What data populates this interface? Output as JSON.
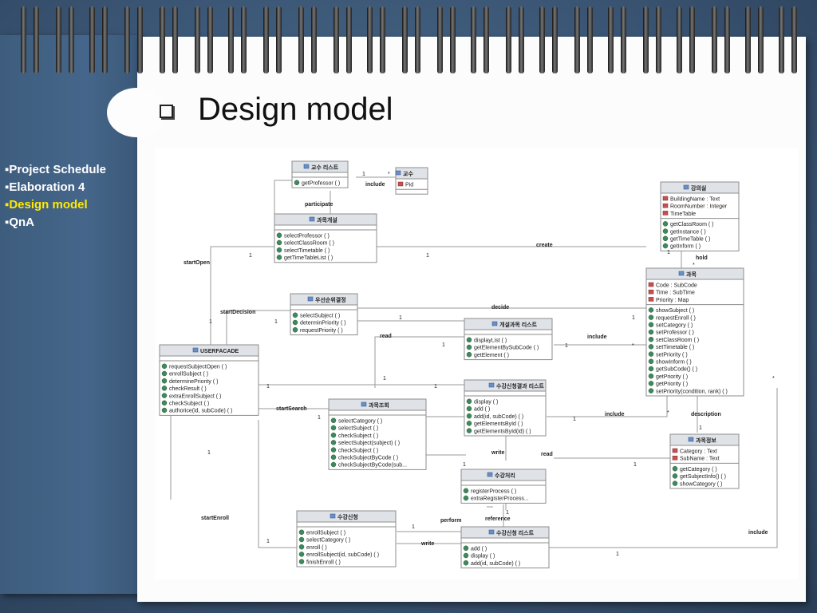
{
  "slide": {
    "title": "Design model"
  },
  "menu": [
    {
      "label": "▪Project Schedule",
      "active": false
    },
    {
      "label": "▪Elaboration 4",
      "active": false
    },
    {
      "label": "▪Design model",
      "active": true
    },
    {
      "label": "▪QnA",
      "active": false
    }
  ],
  "classes": {
    "prof_list": {
      "name": "교수 리스트",
      "attrs": [],
      "ops": [
        "getProfessor ( )"
      ]
    },
    "professor": {
      "name": "교수",
      "attrs": [
        "Pid"
      ],
      "ops": []
    },
    "classroom": {
      "name": "강의실",
      "attrs": [
        "BuildingName : Text",
        "RoomNumber : Integer",
        "TimeTable"
      ],
      "ops": [
        "getClassRoom ( )",
        "getInstance ( )",
        "getTimeTable ( )",
        "getInform ( )"
      ]
    },
    "open_course": {
      "name": "과목개설",
      "attrs": [],
      "ops": [
        "selectProfessor ( )",
        "selectClassRoom ( )",
        "selectTimetable ( )",
        "getTimeTableList ( )"
      ]
    },
    "subject": {
      "name": "과목",
      "attrs": [
        "Code : SubCode",
        "Time : SubTime",
        "Priority : Map"
      ],
      "ops": [
        "showSubject ( )",
        "requestEnroll ( )",
        "setCategory ( )",
        "setProfessor ( )",
        "setClassRoom ( )",
        "setTimetable ( )",
        "setPriority ( )",
        "showInform ( )",
        "getSubCode() ( )",
        "getPriority ( )",
        "getPriority ( )",
        "setPriority(condition, rank) ( )"
      ]
    },
    "priority": {
      "name": "우선순위결정",
      "attrs": [],
      "ops": [
        "selectSubject ( )",
        "determinPriority ( )",
        "requestPriority ( )"
      ]
    },
    "opened_list": {
      "name": "개설과목 리스트",
      "attrs": [],
      "ops": [
        "displayList ( )",
        "getElementBySubCode ( )",
        "getElement ( )"
      ]
    },
    "facade": {
      "name": "USERFACADE",
      "attrs": [],
      "ops": [
        "requestSubjectOpen ( )",
        "enrollSubject ( )",
        "determinePriority ( )",
        "checkResult ( )",
        "extraEnrollSubject ( )",
        "checkSubject ( )",
        "authorice(id, subCode) ( )"
      ]
    },
    "result_list": {
      "name": "수강신청결과 리스트",
      "attrs": [],
      "ops": [
        "display ( )",
        "add ( )",
        "add(id, subCode) ( )",
        "getElementsById ( )",
        "getElementsById(id) ( )"
      ]
    },
    "search": {
      "name": "과목조회",
      "attrs": [],
      "ops": [
        "selectCategory ( )",
        "selectSubject ( )",
        "checkSubject ( )",
        "selectSubject(subject) ( )",
        "checkSubject ( )",
        "checkSubjectByCode ( )",
        "checkSubjectByCode(sub..."
      ]
    },
    "info": {
      "name": "과목정보",
      "attrs": [
        "Category : Text",
        "SubName : Text"
      ],
      "ops": [
        "getCategory ( )",
        "getSubjectInfo() ( )",
        "showCategory ( )"
      ]
    },
    "process": {
      "name": "수강처리",
      "attrs": [],
      "ops": [
        "registerProcess ( )",
        "extraRegisterProcess..."
      ]
    },
    "enroll": {
      "name": "수강신청",
      "attrs": [],
      "ops": [
        "enrollSubject ( )",
        "selectCategory ( )",
        "enroll ( )",
        "enrollSubject(id, subCode) ( )",
        "finishEnroll ( )"
      ]
    },
    "enroll_list": {
      "name": "수강신청 리스트",
      "attrs": [],
      "ops": [
        "add ( )",
        "display ( )",
        "add(id, subCode) ( )"
      ]
    }
  },
  "labels": {
    "include": "include",
    "participate": "participate",
    "create": "create",
    "hold": "hold",
    "startOpen": "startOpen",
    "startDecision": "startDecision",
    "decide": "decide",
    "read": "read",
    "startSearch": "startSearch",
    "description": "description",
    "write": "write",
    "startEnroll": "startEnroll",
    "perform": "perform",
    "reference": "reference",
    "one": "1",
    "star": "*"
  },
  "colors": {
    "header_bg": "#dfe3e8",
    "box_border": "#8d8d8d",
    "line": "#9a9a9a",
    "menu_active": "#ffea00"
  }
}
